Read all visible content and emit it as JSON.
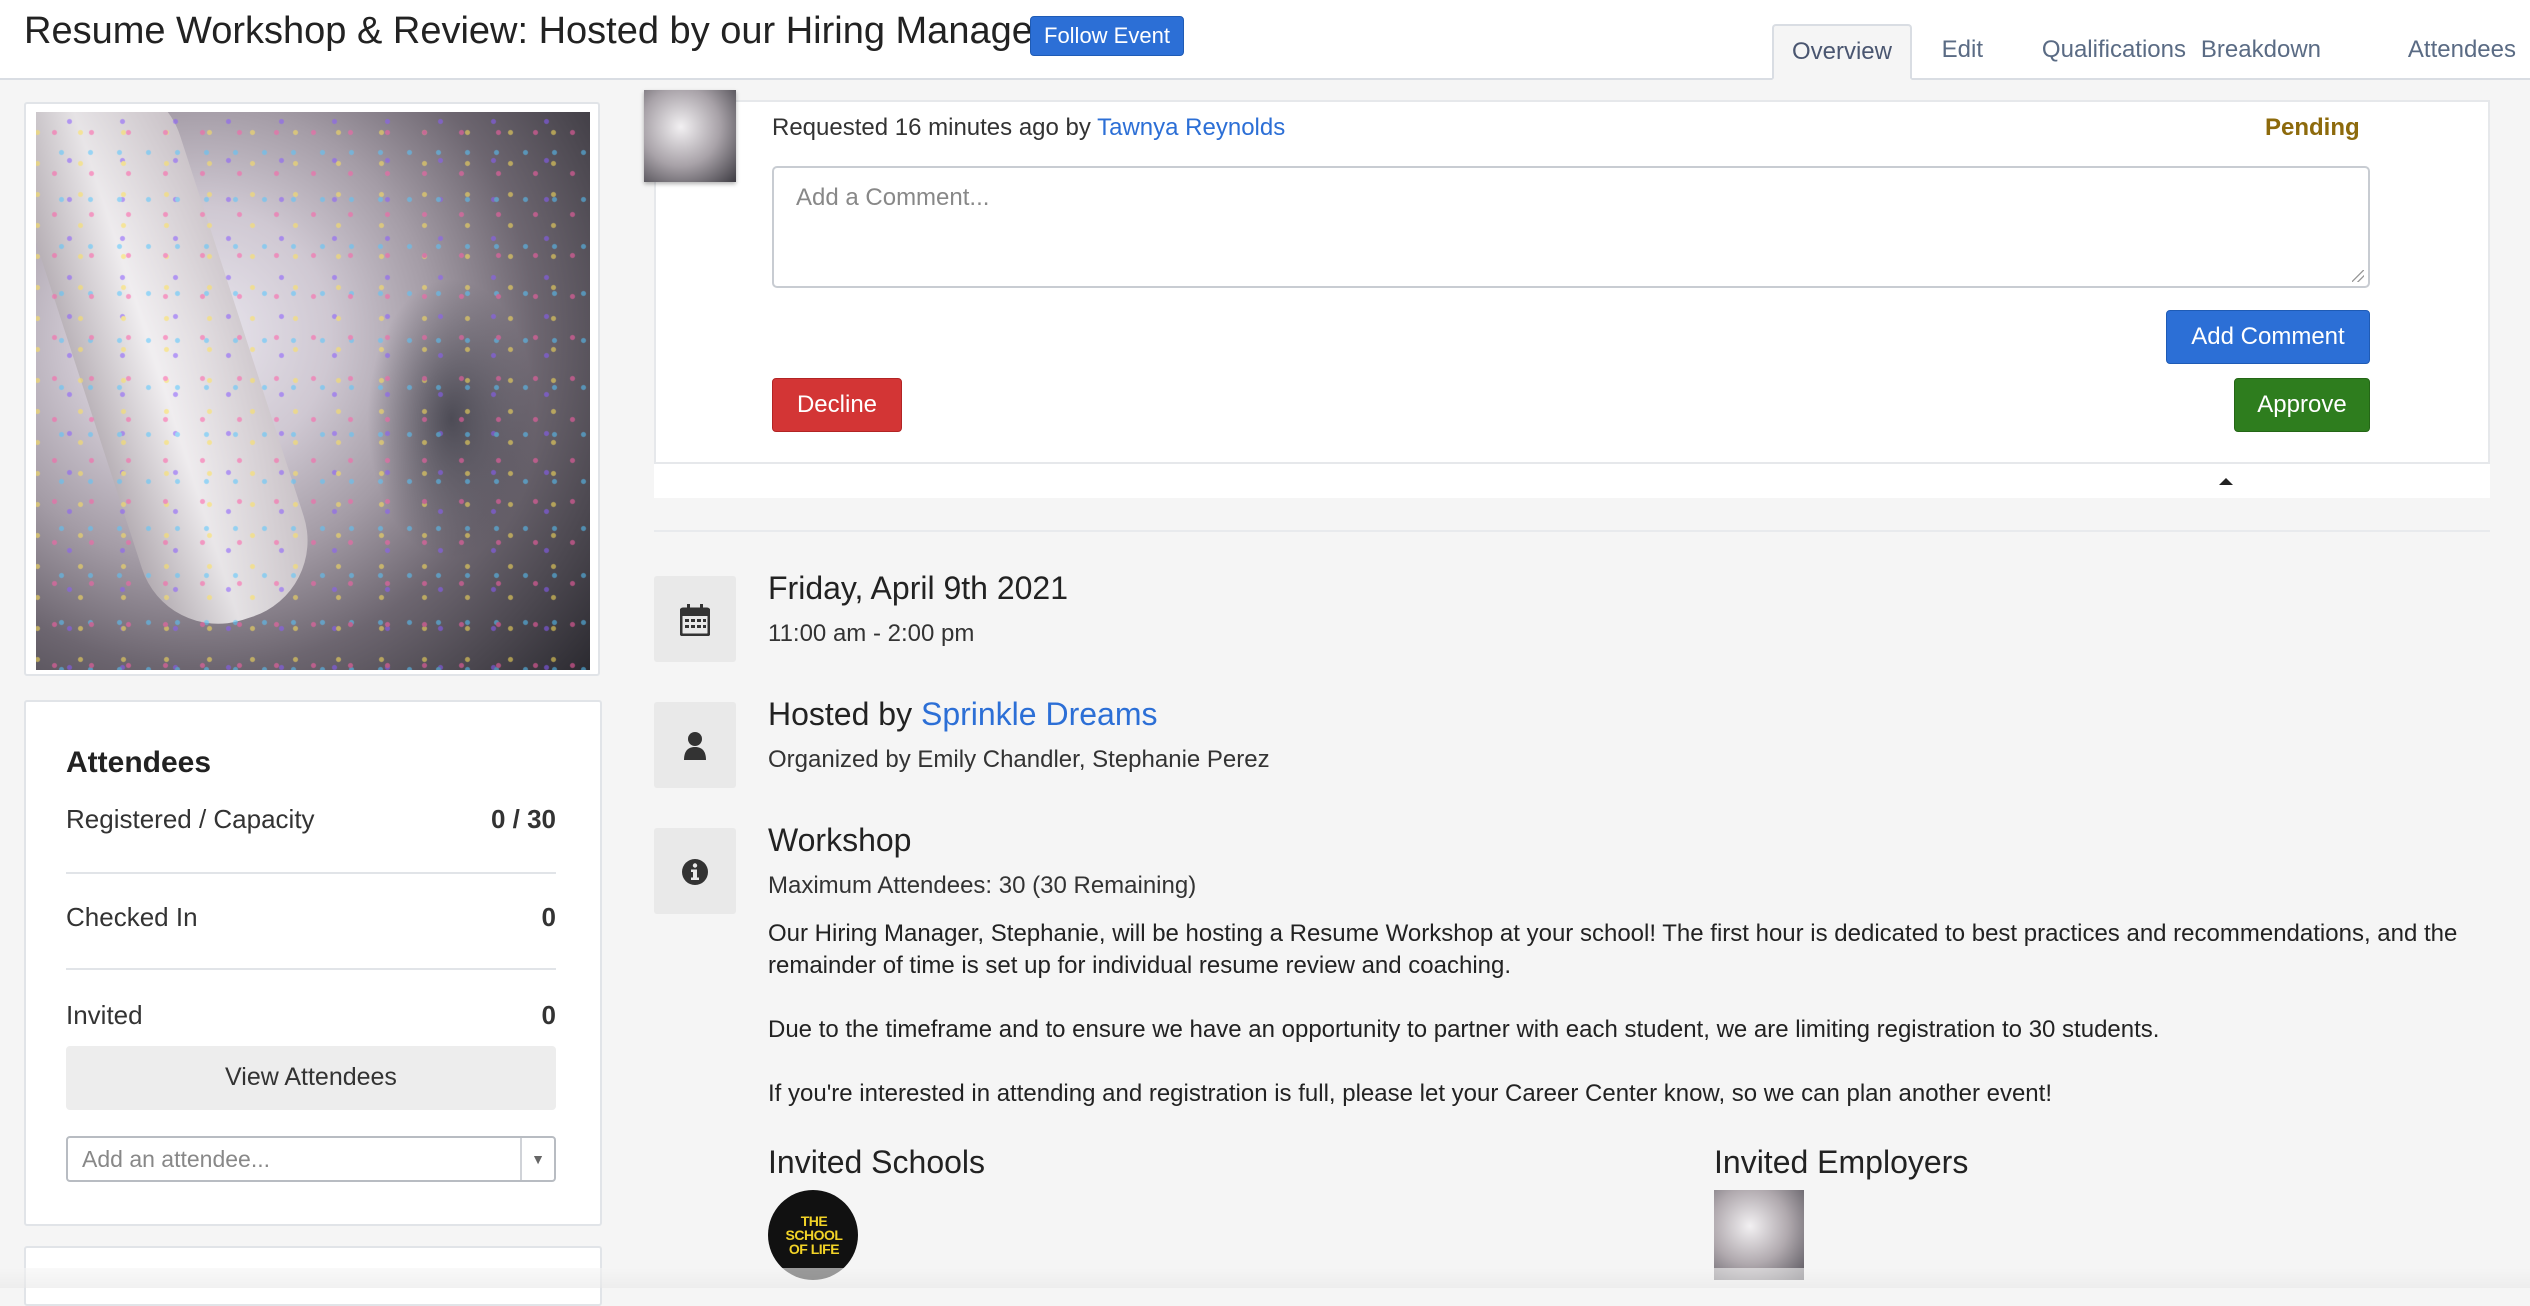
{
  "header": {
    "title": "Resume Workshop & Review: Hosted by our Hiring Manager!",
    "follow_label": "Follow Event",
    "tabs": [
      {
        "label": "Overview",
        "active": true
      },
      {
        "label": "Edit",
        "active": false
      },
      {
        "label": "Qualifications",
        "active": false
      },
      {
        "label": "Breakdown",
        "active": false
      },
      {
        "label": "Attendees",
        "active": false
      }
    ]
  },
  "attendees": {
    "heading": "Attendees",
    "registered_label": "Registered / Capacity",
    "registered_value": "0 / 30",
    "checked_in_label": "Checked In",
    "checked_in_value": "0",
    "invited_label": "Invited",
    "invited_value": "0",
    "view_label": "View Attendees",
    "add_placeholder": "Add an attendee..."
  },
  "request": {
    "prefix": "Requested 16 minutes ago by ",
    "requester": "Tawnya Reynolds",
    "status": "Pending",
    "comment_placeholder": "Add a Comment...",
    "add_comment_label": "Add Comment",
    "decline_label": "Decline",
    "approve_label": "Approve"
  },
  "details": {
    "date": "Friday, April 9th 2021",
    "time": "11:00 am - 2:00 pm",
    "hosted_prefix": "Hosted by ",
    "host": "Sprinkle Dreams",
    "organizers": "Organized by Emily Chandler, Stephanie Perez",
    "type": "Workshop",
    "max_attendees": "Maximum Attendees: 30 (30 Remaining)",
    "description": [
      "Our Hiring Manager, Stephanie, will be hosting a Resume Workshop at your school! The first hour is dedicated to best practices and recommendations, and the remainder of time is set up for individual resume review and coaching.",
      "Due to the timeframe and to ensure we have an opportunity to partner with each student, we are limiting registration to 30 students.",
      "If you're interested in attending and registration is full, please let your Career Center know, so we can plan another event!"
    ],
    "invited_schools_label": "Invited Schools",
    "invited_employers_label": "Invited Employers",
    "school_logo_text": "THE SCHOOL OF LIFE"
  },
  "icons": {
    "date": "calendar-icon",
    "host": "user-icon",
    "info": "info-icon"
  },
  "colors": {
    "primary": "#2c6fd6",
    "danger": "#d33535",
    "success": "#2e7d1e",
    "pending": "#8d6a0c"
  }
}
